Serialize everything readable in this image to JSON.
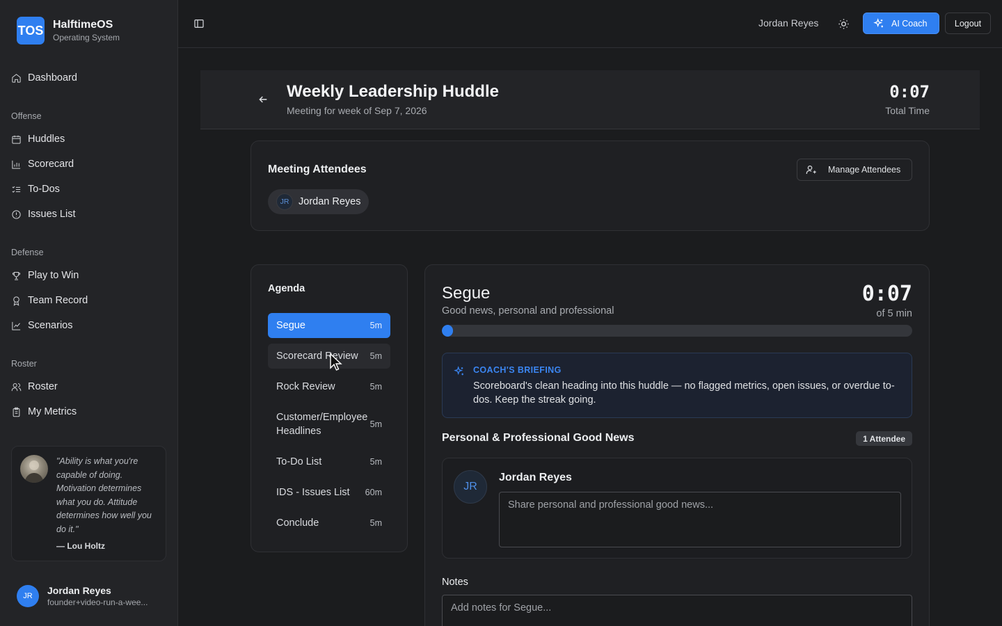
{
  "brand": {
    "logo": "TOS",
    "name": "HalftimeOS",
    "subtitle": "Operating System"
  },
  "sidebar": {
    "dashboard": "Dashboard",
    "sections": {
      "offense": "Offense",
      "defense": "Defense",
      "roster": "Roster"
    },
    "offense_items": [
      "Huddles",
      "Scorecard",
      "To-Dos",
      "Issues List"
    ],
    "defense_items": [
      "Play to Win",
      "Team Record",
      "Scenarios"
    ],
    "roster_items": [
      "Roster",
      "My Metrics"
    ],
    "quote": {
      "text": "\"Ability is what you're capable of doing. Motivation determines what you do. Attitude determines how well you do it.\"",
      "author": "— Lou Holtz"
    },
    "user": {
      "initials": "JR",
      "name": "Jordan Reyes",
      "email": "founder+video-run-a-wee..."
    }
  },
  "topbar": {
    "user": "Jordan Reyes",
    "ai_coach": "AI Coach",
    "logout": "Logout"
  },
  "meeting": {
    "title": "Weekly Leadership Huddle",
    "subtitle": "Meeting for week of Sep 7, 2026",
    "total_time": "0:07",
    "total_label": "Total Time"
  },
  "attendees": {
    "title": "Meeting Attendees",
    "manage": "Manage Attendees",
    "list": [
      {
        "initials": "JR",
        "name": "Jordan Reyes"
      }
    ]
  },
  "agenda": {
    "title": "Agenda",
    "items": [
      {
        "label": "Segue",
        "duration": "5m"
      },
      {
        "label": "Scorecard Review",
        "duration": "5m"
      },
      {
        "label": "Rock Review",
        "duration": "5m"
      },
      {
        "label": "Customer/Employee Headlines",
        "duration": "5m"
      },
      {
        "label": "To-Do List",
        "duration": "5m"
      },
      {
        "label": "IDS - Issues List",
        "duration": "60m"
      },
      {
        "label": "Conclude",
        "duration": "5m"
      }
    ]
  },
  "segue": {
    "title": "Segue",
    "subtitle": "Good news, personal and professional",
    "timer": "0:07",
    "of": "of 5 min",
    "progress": 0.023,
    "briefing_title": "COACH'S BRIEFING",
    "briefing_text": "Scoreboard's clean heading into this huddle — no flagged metrics, open issues, or overdue to-dos. Keep the streak going.",
    "good_news_title": "Personal & Professional Good News",
    "attendee_badge": "1 Attendee",
    "person": {
      "initials": "JR",
      "name": "Jordan Reyes"
    },
    "news_placeholder": "Share personal and professional good news...",
    "notes_label": "Notes",
    "notes_placeholder": "Add notes for Segue..."
  },
  "colors": {
    "accent": "#2f7ff0",
    "background": "#1b1c1e",
    "sidebar": "#232427"
  }
}
